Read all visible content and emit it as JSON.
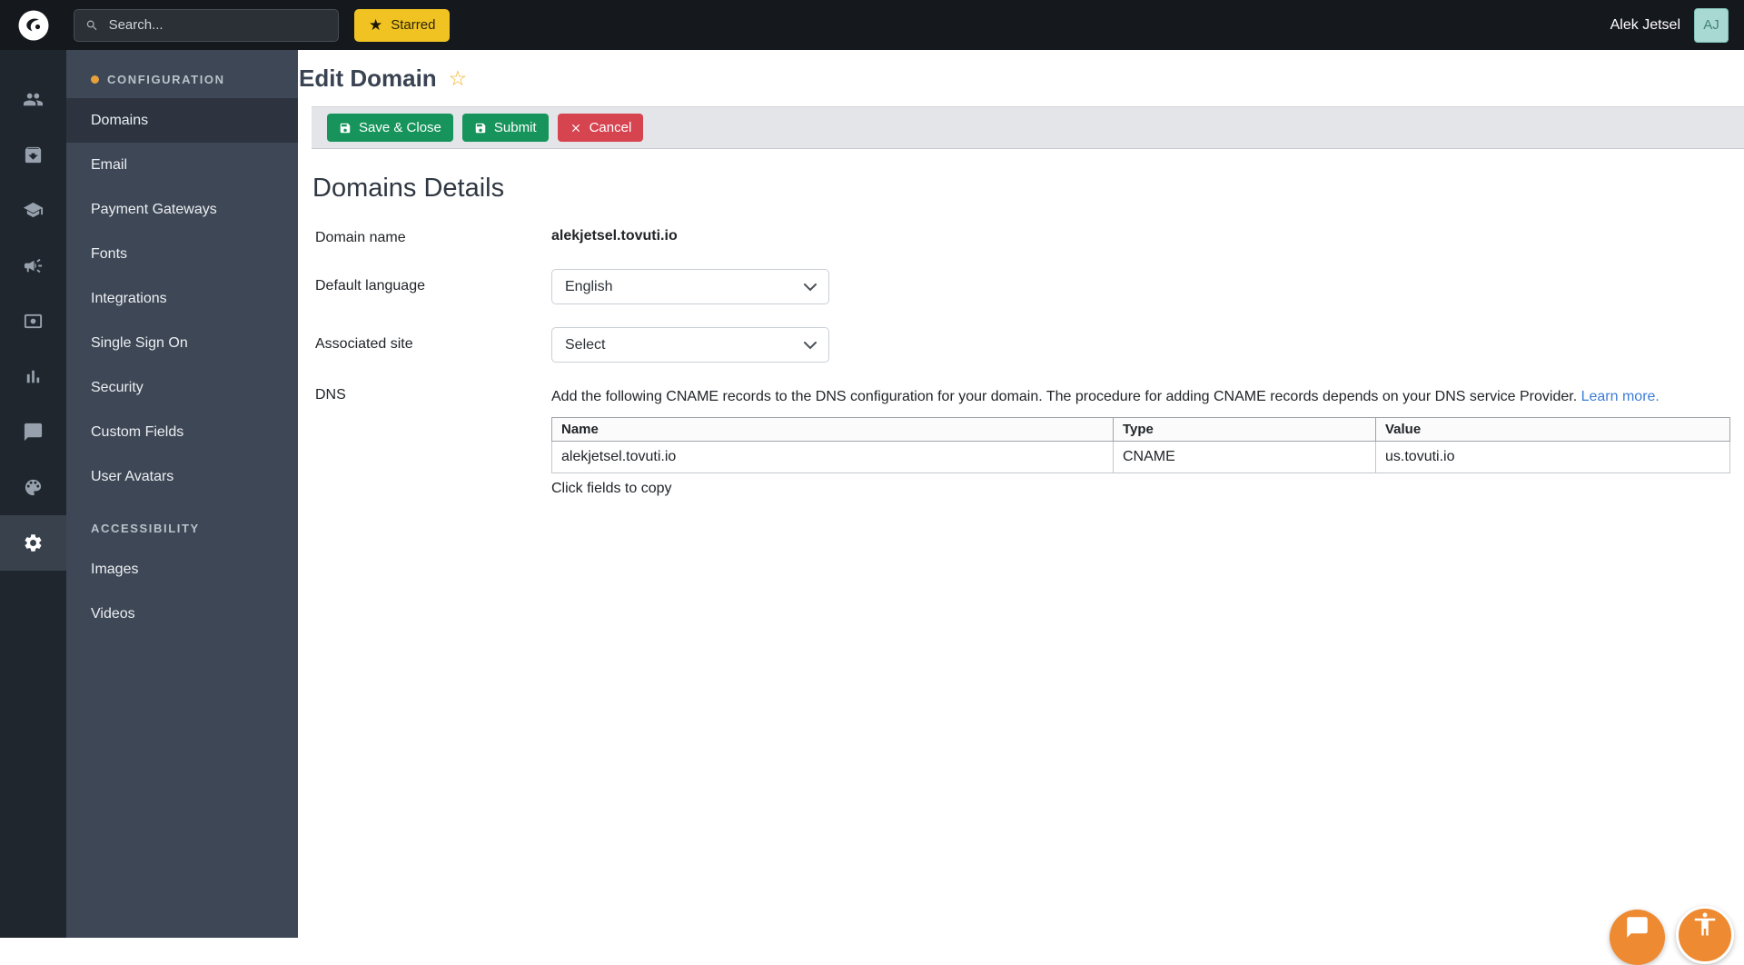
{
  "topbar": {
    "search_placeholder": "Search...",
    "starred_label": "Starred",
    "user_name": "Alek Jetsel",
    "avatar_initials": "AJ"
  },
  "icons": {
    "star_filled": "★",
    "star_outline": "☆",
    "rail": [
      "users",
      "library",
      "courses",
      "marketing",
      "media",
      "reports",
      "messages",
      "design",
      "settings"
    ]
  },
  "sidebar": {
    "sections": [
      {
        "title": "CONFIGURATION",
        "items": [
          "Domains",
          "Email",
          "Payment Gateways",
          "Fonts",
          "Integrations",
          "Single Sign On",
          "Security",
          "Custom Fields",
          "User Avatars"
        ]
      },
      {
        "title": "ACCESSIBILITY",
        "items": [
          "Images",
          "Videos"
        ]
      }
    ],
    "active_item": "Domains"
  },
  "page": {
    "title": "Edit Domain",
    "toolbar": {
      "save_close": "Save & Close",
      "submit": "Submit",
      "cancel": "Cancel"
    },
    "section_title": "Domains Details",
    "form": {
      "domain_name_label": "Domain name",
      "domain_name_value": "alekjetsel.tovuti.io",
      "default_language_label": "Default language",
      "default_language_value": "English",
      "associated_site_label": "Associated site",
      "associated_site_value": "Select",
      "dns_label": "DNS",
      "dns_help": "Add the following CNAME records to the DNS configuration for your domain. The procedure for adding CNAME records depends on your DNS service Provider.",
      "dns_learn_more": "Learn more.",
      "copy_hint": "Click fields to copy"
    },
    "dns_table": {
      "headers": [
        "Name",
        "Type",
        "Value"
      ],
      "rows": [
        [
          "alekjetsel.tovuti.io",
          "CNAME",
          "us.tovuti.io"
        ]
      ]
    }
  },
  "colors": {
    "topbar_bg": "#15181D",
    "rail_bg": "#20262E",
    "sidebar_bg": "#3E4755",
    "accent_yellow": "#F0C323",
    "accent_orange": "#E7A03C",
    "button_green": "#16945B",
    "button_red": "#D64450",
    "link_blue": "#3B7DD8",
    "fab_orange": "#EE8A31",
    "avatar_bg": "#A9D9D3"
  }
}
